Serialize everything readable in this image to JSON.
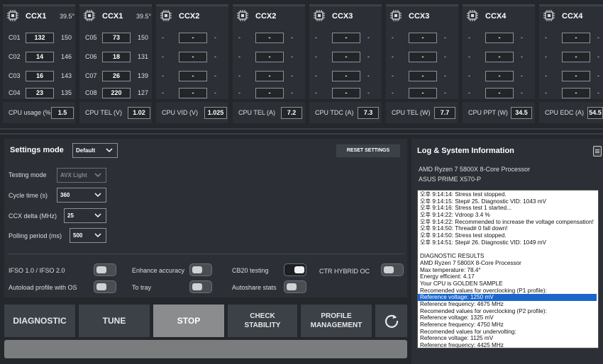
{
  "ccx_panels": [
    {
      "title": "CCX1",
      "temp": "39.5°",
      "cores": [
        {
          "label": "C01",
          "value": "132",
          "max": "150"
        },
        {
          "label": "C02",
          "value": "14",
          "max": "146"
        },
        {
          "label": "C03",
          "value": "16",
          "max": "143"
        },
        {
          "label": "C04",
          "value": "23",
          "max": "135"
        }
      ]
    },
    {
      "title": "CCX1",
      "temp": "39.5°",
      "cores": [
        {
          "label": "C05",
          "value": "73",
          "max": "150"
        },
        {
          "label": "C06",
          "value": "18",
          "max": "131"
        },
        {
          "label": "C07",
          "value": "26",
          "max": "139"
        },
        {
          "label": "C08",
          "value": "220",
          "max": "127"
        }
      ]
    },
    {
      "title": "CCX2",
      "temp": "",
      "cores": [
        {
          "label": "-",
          "value": "-",
          "max": "-"
        },
        {
          "label": "-",
          "value": "-",
          "max": "-"
        },
        {
          "label": "-",
          "value": "-",
          "max": "-"
        },
        {
          "label": "-",
          "value": "-",
          "max": "-"
        }
      ]
    },
    {
      "title": "CCX2",
      "temp": "",
      "cores": [
        {
          "label": "-",
          "value": "-",
          "max": "-"
        },
        {
          "label": "-",
          "value": "-",
          "max": "-"
        },
        {
          "label": "-",
          "value": "-",
          "max": "-"
        },
        {
          "label": "-",
          "value": "-",
          "max": "-"
        }
      ]
    },
    {
      "title": "CCX3",
      "temp": "",
      "cores": [
        {
          "label": "-",
          "value": "-",
          "max": "-"
        },
        {
          "label": "-",
          "value": "-",
          "max": "-"
        },
        {
          "label": "-",
          "value": "-",
          "max": "-"
        },
        {
          "label": "-",
          "value": "-",
          "max": "-"
        }
      ]
    },
    {
      "title": "CCX3",
      "temp": "",
      "cores": [
        {
          "label": "-",
          "value": "-",
          "max": "-"
        },
        {
          "label": "-",
          "value": "-",
          "max": "-"
        },
        {
          "label": "-",
          "value": "-",
          "max": "-"
        },
        {
          "label": "-",
          "value": "-",
          "max": "-"
        }
      ]
    },
    {
      "title": "CCX4",
      "temp": "",
      "cores": [
        {
          "label": "-",
          "value": "-",
          "max": "-"
        },
        {
          "label": "-",
          "value": "-",
          "max": "-"
        },
        {
          "label": "-",
          "value": "-",
          "max": "-"
        },
        {
          "label": "-",
          "value": "-",
          "max": "-"
        }
      ]
    },
    {
      "title": "CCX4",
      "temp": "",
      "cores": [
        {
          "label": "-",
          "value": "-",
          "max": "-"
        },
        {
          "label": "-",
          "value": "-",
          "max": "-"
        },
        {
          "label": "-",
          "value": "-",
          "max": "-"
        },
        {
          "label": "-",
          "value": "-",
          "max": "-"
        }
      ]
    }
  ],
  "stats": [
    {
      "label": "CPU usage (%)",
      "value": "1.5"
    },
    {
      "label": "CPU TEL (V)",
      "value": "1.02"
    },
    {
      "label": "CPU VID (V)",
      "value": "1.025"
    },
    {
      "label": "CPU TEL (A)",
      "value": "7.2"
    },
    {
      "label": "CPU TDC (A)",
      "value": "7.3"
    },
    {
      "label": "CPU TEL (W)",
      "value": "7.7"
    },
    {
      "label": "CPU PPT (W)",
      "value": "34.5"
    },
    {
      "label": "CPU EDC (A)",
      "value": "54.5"
    }
  ],
  "settings": {
    "title": "Settings mode",
    "mode_value": "Default",
    "reset_label": "RESET SETTINGS",
    "testing_mode": {
      "label": "Testing mode",
      "value": "AVX Light"
    },
    "cycle_time": {
      "label": "Cycle time (s)",
      "value": "360"
    },
    "ccx_delta": {
      "label": "CCX delta (MHz)",
      "value": "25"
    },
    "polling": {
      "label": "Polling period (ms)",
      "value": "500"
    },
    "toggles": {
      "ifso": "IFSO 1.0 / IFSO 2.0",
      "enhance": "Enhance accuracy",
      "cb20": "CB20 testing",
      "ctr_hybrid": "CTR HYBRID OC",
      "autoload": "Autoload profile with OS",
      "tray": "To tray",
      "autoshare": "Autoshare stats"
    }
  },
  "buttons": {
    "diagnostic": "DIAGNOSTIC",
    "tune": "TUNE",
    "stop": "STOP",
    "check_1": "CHECK",
    "check_2": "STABILITY",
    "profile_1": "PROFILE",
    "profile_2": "MANAGEMENT"
  },
  "log": {
    "title": "Log & System Information",
    "cpu": "AMD Ryzen 7 5800X 8-Core Processor",
    "board": "ASUS PRIME X570-P",
    "lines": [
      "오후 9:14:14: Stress test stopped.",
      "오후 9:14:15: Step# 25. Diagnostic VID: 1043 mV",
      "오후 9:14:16: Stress test 1 started...",
      "오후 9:14:22: Vdroop 3.4 %",
      "오후 9:14:22: Recommended to increase the voltage compensation!",
      "오후 9:14:50: Thread# 0 fall down!",
      "오후 9:14:50: Stress test stopped.",
      "오후 9:14:51: Step# 26. Diagnostic VID: 1049 mV",
      "",
      "DIAGNOSTIC RESULTS",
      "AMD Ryzen 7 5800X 8-Core Processor",
      "Max temperature: 78.4°",
      "Energy efficient: 4.17",
      "Your CPU is GOLDEN SAMPLE",
      "Recomended values for overclocking (P1 profile):",
      "Reference voltage: 1250 mV",
      "Reference frequency: 4675 MHz",
      "Recomended values for overclocking (P2 profile):",
      "Reference voltage: 1325 mV",
      "Reference frequency: 4750 MHz",
      "Recomended values for undervolting:",
      "Reference voltage: 1125 mV",
      "Reference frequency: 4425 MHz"
    ]
  }
}
